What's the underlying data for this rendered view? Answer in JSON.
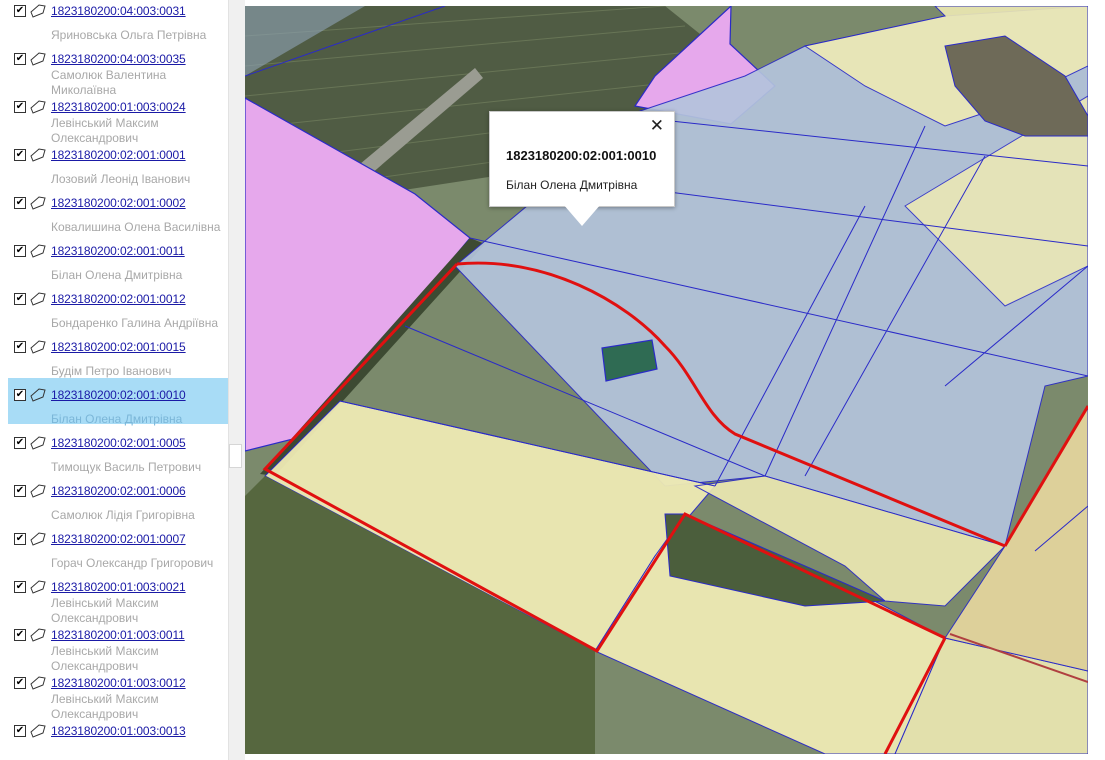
{
  "parcels": [
    {
      "cad": "1823180200:04:003:0031",
      "owner": "Яриновська Ольга Петрівна",
      "checked": true,
      "selected": false
    },
    {
      "cad": "1823180200:04:003:0035",
      "owner": "Самолюк Валентина Миколаївна",
      "checked": true,
      "selected": false
    },
    {
      "cad": "1823180200:01:003:0024",
      "owner": "Левінський Максим Олександрович",
      "checked": true,
      "selected": false
    },
    {
      "cad": "1823180200:02:001:0001",
      "owner": "Лозовий Леонід Іванович",
      "checked": true,
      "selected": false
    },
    {
      "cad": "1823180200:02:001:0002",
      "owner": "Ковалишина Олена Василівна",
      "checked": true,
      "selected": false
    },
    {
      "cad": "1823180200:02:001:0011",
      "owner": "Білан Олена Дмитрівна",
      "checked": true,
      "selected": false
    },
    {
      "cad": "1823180200:02:001:0012",
      "owner": "Бондаренко Галина Андріївна",
      "checked": true,
      "selected": false
    },
    {
      "cad": "1823180200:02:001:0015",
      "owner": "Будім Петро Іванович",
      "checked": true,
      "selected": false
    },
    {
      "cad": "1823180200:02:001:0010",
      "owner": "Білан Олена Дмитрівна",
      "checked": true,
      "selected": true
    },
    {
      "cad": "1823180200:02:001:0005",
      "owner": "Тимощук Василь Петрович",
      "checked": true,
      "selected": false
    },
    {
      "cad": "1823180200:02:001:0006",
      "owner": "Самолюк Лідія Григорівна",
      "checked": true,
      "selected": false
    },
    {
      "cad": "1823180200:02:001:0007",
      "owner": "Горач Олександр Григорович",
      "checked": true,
      "selected": false
    },
    {
      "cad": "1823180200:01:003:0021",
      "owner": "Левінський Максим Олександрович",
      "checked": true,
      "selected": false
    },
    {
      "cad": "1823180200:01:003:0011",
      "owner": "Левінський Максим Олександрович",
      "checked": true,
      "selected": false
    },
    {
      "cad": "1823180200:01:003:0012",
      "owner": "Левінський Максим Олександрович",
      "checked": true,
      "selected": false
    },
    {
      "cad": "1823180200:01:003:0013",
      "owner": "",
      "checked": true,
      "selected": false
    }
  ],
  "checkbox_mark": "✔",
  "popup": {
    "title": "1823180200:02:001:0010",
    "owner": "Білан Олена Дмитрівна",
    "close_glyph": "✕"
  },
  "icons": {
    "list_item": "polygon-shape-icon",
    "close": "close-icon"
  },
  "colors": {
    "selected_row": "#a8dcf6",
    "link": "#1a1aa6",
    "owner_text": "#a8a8a8",
    "parcel_border": "#2a2ac8",
    "highlight_outline": "#e01010",
    "parcel_fill_yellow": "#eeeab4",
    "parcel_fill_blue": "#b4c4dc",
    "parcel_fill_pink": "#e6a8ec",
    "selected_parcel_fill": "#2f6b53"
  }
}
